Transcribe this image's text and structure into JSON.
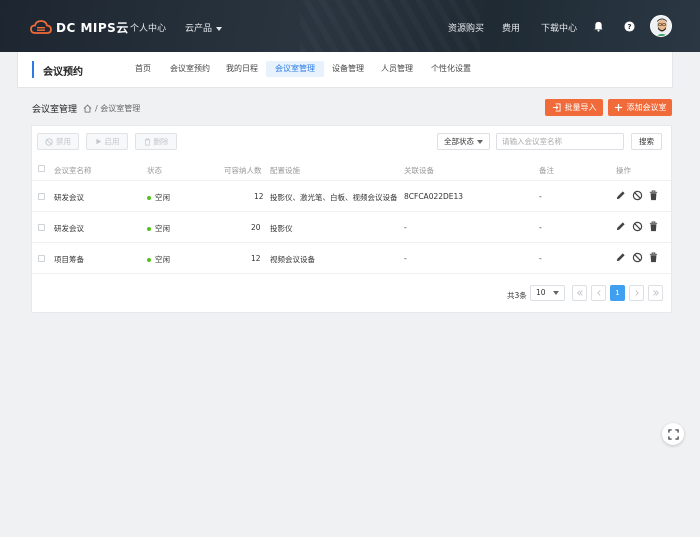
{
  "brand": {
    "logo_text": "DC MIPS云"
  },
  "topnav": {
    "personal_center": "个人中心",
    "cloud_products": "云产品",
    "resource_purchase": "资源购买",
    "fees": "费用",
    "download_center": "下载中心"
  },
  "subheader": {
    "title": "会议预约",
    "tabs": [
      {
        "label": "首页"
      },
      {
        "label": "会议室预约"
      },
      {
        "label": "我的日程"
      },
      {
        "label": "会议室管理"
      },
      {
        "label": "设备管理"
      },
      {
        "label": "人员管理"
      },
      {
        "label": "个性化设置"
      }
    ],
    "active_tab": "会议室管理"
  },
  "breadcrumb": {
    "title": "会议室管理",
    "path": "/ 会议室管理"
  },
  "actions": {
    "batch_import": "批量导入",
    "add_room": "添加会议室"
  },
  "toolbar": {
    "disable": "禁用",
    "enable": "启用",
    "delete": "删除",
    "status_filter": "全部状态",
    "search_placeholder": "请输入会议室名称",
    "search_btn": "搜索"
  },
  "table": {
    "headers": {
      "name": "会议室名称",
      "status": "状态",
      "capacity": "可容纳人数",
      "facilities": "配置设施",
      "devices": "关联设备",
      "remark": "备注",
      "ops": "操作"
    },
    "rows": [
      {
        "name": "研发会议",
        "status": "空闲",
        "capacity": "12",
        "facilities": "投影仪、激光笔、白板、视频会议设备",
        "devices": "8CFCA022DE13",
        "remark": "-"
      },
      {
        "name": "研发会议",
        "status": "空闲",
        "capacity": "20",
        "facilities": "投影仪",
        "devices": "-",
        "remark": "-"
      },
      {
        "name": "项目筹备",
        "status": "空闲",
        "capacity": "12",
        "facilities": "视频会议设备",
        "devices": "-",
        "remark": "-"
      }
    ]
  },
  "pagination": {
    "total": "共3条",
    "page_size": "10",
    "current_page": "1"
  },
  "colors": {
    "accent": "#2c7be5",
    "orange": "#f06a3a",
    "status_idle": "#52c41a"
  }
}
